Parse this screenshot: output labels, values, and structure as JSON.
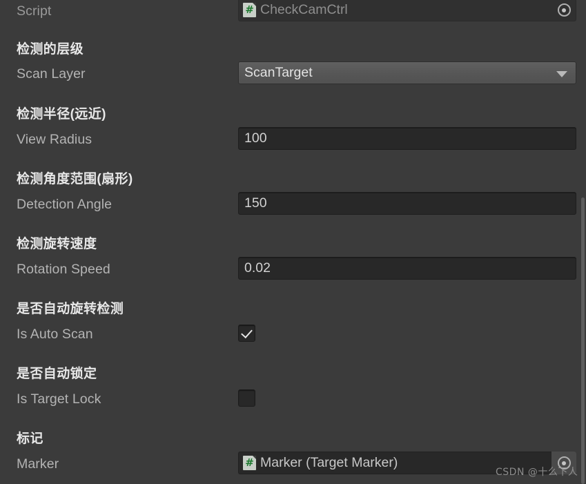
{
  "panel": {
    "name": "unity-inspector-component",
    "background_color": "#3b3b3b",
    "field_color": "#282828",
    "dropdown_color": "#585858",
    "accent_green": "#1d7a2f"
  },
  "script_row": {
    "label": "Script",
    "value": "CheckCamCtrl",
    "icon": "csharp-script-icon",
    "icon_glyph": "#",
    "picker": "object-picker-icon"
  },
  "properties": [
    {
      "cn_header": "检测的层级",
      "label": "Scan Layer",
      "type": "dropdown",
      "value": "ScanTarget"
    },
    {
      "cn_header": "检测半径(远近)",
      "label": "View Radius",
      "type": "number",
      "value": "100"
    },
    {
      "cn_header": "检测角度范围(扇形)",
      "label": "Detection Angle",
      "type": "number",
      "value": "150"
    },
    {
      "cn_header": "检测旋转速度",
      "label": "Rotation Speed",
      "type": "number",
      "value": "0.02"
    },
    {
      "cn_header": "是否自动旋转检测",
      "label": "Is Auto Scan",
      "type": "checkbox",
      "checked": true
    },
    {
      "cn_header": "是否自动锁定",
      "label": "Is Target Lock",
      "type": "checkbox",
      "checked": false
    },
    {
      "cn_header": "标记",
      "label": "Marker",
      "type": "object",
      "value": "Marker (Target Marker)",
      "icon_glyph": "#"
    }
  ],
  "watermark": {
    "text": "CSDN @十么下人"
  }
}
